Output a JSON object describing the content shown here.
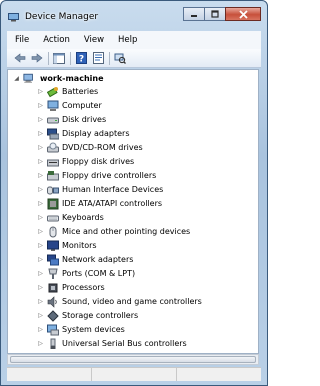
{
  "window": {
    "title": "Device Manager",
    "controls": {
      "minimize": "—",
      "maximize": "☐",
      "close": "✕"
    }
  },
  "menu": [
    "File",
    "Action",
    "View",
    "Help"
  ],
  "toolbar": [
    "back-arrow-icon",
    "forward-arrow-icon",
    "console-tree-icon",
    "help-icon",
    "properties-icon",
    "scan-hardware-icon"
  ],
  "tree": {
    "root": {
      "label": "work-machine",
      "expander": "◢"
    },
    "expander_collapsed": "▷",
    "items": [
      {
        "label": "Batteries",
        "icon": "battery-icon"
      },
      {
        "label": "Computer",
        "icon": "computer-icon"
      },
      {
        "label": "Disk drives",
        "icon": "disk-drive-icon"
      },
      {
        "label": "Display adapters",
        "icon": "display-adapter-icon"
      },
      {
        "label": "DVD/CD-ROM drives",
        "icon": "dvd-drive-icon"
      },
      {
        "label": "Floppy disk drives",
        "icon": "floppy-drive-icon"
      },
      {
        "label": "Floppy drive controllers",
        "icon": "floppy-controller-icon"
      },
      {
        "label": "Human Interface Devices",
        "icon": "hid-icon"
      },
      {
        "label": "IDE ATA/ATAPI controllers",
        "icon": "ide-controller-icon"
      },
      {
        "label": "Keyboards",
        "icon": "keyboard-icon"
      },
      {
        "label": "Mice and other pointing devices",
        "icon": "mouse-icon"
      },
      {
        "label": "Monitors",
        "icon": "monitor-icon"
      },
      {
        "label": "Network adapters",
        "icon": "network-adapter-icon"
      },
      {
        "label": "Ports (COM & LPT)",
        "icon": "port-icon"
      },
      {
        "label": "Processors",
        "icon": "processor-icon"
      },
      {
        "label": "Sound, video and game controllers",
        "icon": "sound-icon"
      },
      {
        "label": "Storage controllers",
        "icon": "storage-controller-icon"
      },
      {
        "label": "System devices",
        "icon": "system-device-icon"
      },
      {
        "label": "Universal Serial Bus controllers",
        "icon": "usb-icon"
      }
    ]
  }
}
